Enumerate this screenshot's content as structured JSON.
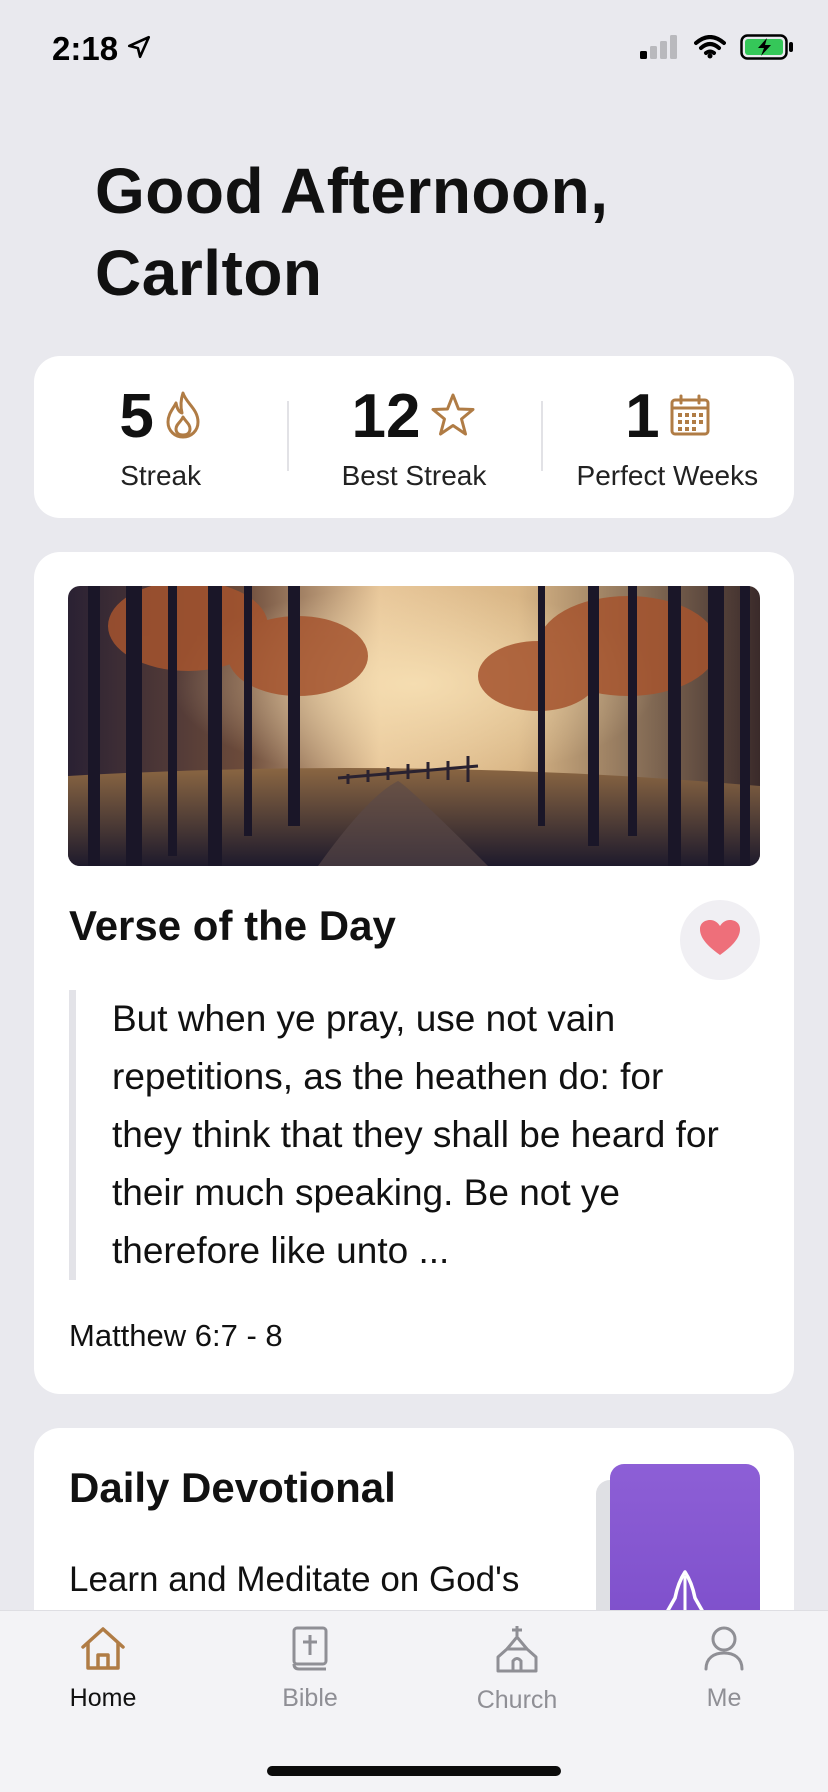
{
  "status_bar": {
    "time": "2:18",
    "icons": [
      "location-arrow-icon",
      "signal-icon",
      "wifi-icon",
      "battery-charging-icon"
    ]
  },
  "greeting": "Good Afternoon, Carlton",
  "stats": [
    {
      "value": "5",
      "label": "Streak",
      "icon": "flame-icon"
    },
    {
      "value": "12",
      "label": "Best Streak",
      "icon": "star-icon"
    },
    {
      "value": "1",
      "label": "Perfect Weeks",
      "icon": "calendar-icon"
    }
  ],
  "verse": {
    "title": "Verse of the Day",
    "text": "But when ye pray, use not vain repetitions, as the heathen do: for they think that they shall be heard for their much speaking. Be not ye therefore like unto ...",
    "reference": "Matthew 6:7 - 8",
    "image_icon": "autumn-forest-path-image",
    "favorite_icon": "heart-icon"
  },
  "devotional": {
    "title": "Daily Devotional",
    "subtitle": "Learn and Meditate on God's",
    "thumb_icon": "praying-hands-icon"
  },
  "tabs": [
    {
      "label": "Home",
      "icon": "home-icon",
      "active": true
    },
    {
      "label": "Bible",
      "icon": "bible-icon",
      "active": false
    },
    {
      "label": "Church",
      "icon": "church-icon",
      "active": false
    },
    {
      "label": "Me",
      "icon": "person-icon",
      "active": false
    }
  ],
  "colors": {
    "accent": "#b07c45",
    "background": "#e9e9ee",
    "card": "#ffffff",
    "heart": "#ee6f7a",
    "devotional": "#8055cf",
    "tab_inactive": "#8f8f95"
  }
}
